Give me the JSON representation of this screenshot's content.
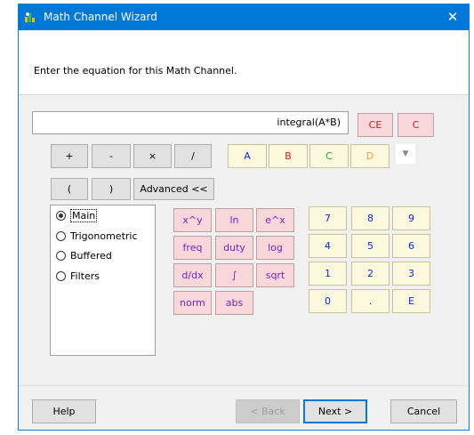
{
  "window": {
    "title": "Math Channel Wizard",
    "close_glyph": "✕"
  },
  "instruction": "Enter the equation for this Math Channel.",
  "equation": "integral(A*B)",
  "clear": {
    "ce": "CE",
    "c": "C"
  },
  "operators": [
    "+",
    "-",
    "×",
    "/"
  ],
  "channels": [
    "A",
    "B",
    "C",
    "D"
  ],
  "channel_colors": {
    "A": "#0a2bd8",
    "B": "#d51a1a",
    "C": "#22aa22",
    "D": "#e8a63a"
  },
  "dropdown_glyph": "▼",
  "parens": {
    "open": "(",
    "close": ")"
  },
  "advanced_label": "Advanced <<",
  "function_groups": [
    "Main",
    "Trigonometric",
    "Buffered",
    "Filters"
  ],
  "selected_group": "Main",
  "functions": [
    "x^y",
    "ln",
    "e^x",
    "freq",
    "duty",
    "log",
    "d/dx",
    "∫",
    "sqrt",
    "norm",
    "abs"
  ],
  "keypad": [
    "7",
    "8",
    "9",
    "4",
    "5",
    "6",
    "1",
    "2",
    "3",
    "0",
    ".",
    "E"
  ],
  "footer": {
    "help": "Help",
    "back": "< Back",
    "next": "Next >",
    "cancel": "Cancel"
  }
}
